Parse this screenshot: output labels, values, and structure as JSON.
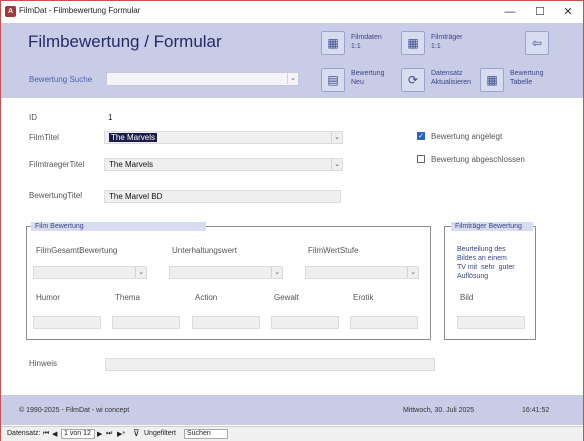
{
  "window": {
    "title": "FilmDat - Filmbewertung Formular",
    "minimize": "—",
    "maximize": "☐",
    "close": "✕"
  },
  "header": {
    "title": "Filmbewertung / Formular",
    "search_label": "Bewertung Suche",
    "buttons": {
      "filmdaten": "Filmdaten\n1:1",
      "filmtraeger": "Filmträger\n1:1",
      "bewertung_neu": "Bewertung\nNeu",
      "datensatz_aktualisieren": "Datensatz\nAktualisieren",
      "bewertung_tabelle": "Bewertung\nTabelle"
    }
  },
  "form": {
    "id_label": "ID",
    "id_value": "1",
    "filmtitel_label": "FilmTitel",
    "filmtitel_value": "The Marvels",
    "filmtraegertitel_label": "FilmtraegerTitel",
    "filmtraegertitel_value": "The Marvels",
    "bewertungtitel_label": "BewertungTitel",
    "bewertungtitel_value": "The Marvel BD",
    "check_angelegt": "Bewertung angelegt",
    "check_angelegt_checked": true,
    "check_abgeschlossen": "Bewertung abgeschlossen",
    "check_abgeschlossen_checked": false,
    "hinweis_label": "Hinweis"
  },
  "film_bewertung": {
    "title": "Film Bewertung",
    "gesamt": "FilmGesamtBewertung",
    "unterhaltung": "Unterhaltungswert",
    "wertstufe": "FilmWertStufe",
    "humor": "Humor",
    "thema": "Thema",
    "action": "Action",
    "gewalt": "Gewalt",
    "erotik": "Erotik"
  },
  "filmtraeger_bewertung": {
    "title": "Filmträger Bewertung",
    "description": "Beurteilung des\nBildes an einem\nTV mit  sehr  guter\nAuflösung",
    "bild": "Bild"
  },
  "footer": {
    "copyright": "© 1990-2025 - FilmDat - wi concept",
    "date": "Mittwoch, 30. Juli 2025",
    "time": "16:41:52"
  },
  "navigation": {
    "label": "Datensatz:",
    "position": "1 von 12",
    "filter": "Ungefiltert",
    "search": "Suchen"
  }
}
